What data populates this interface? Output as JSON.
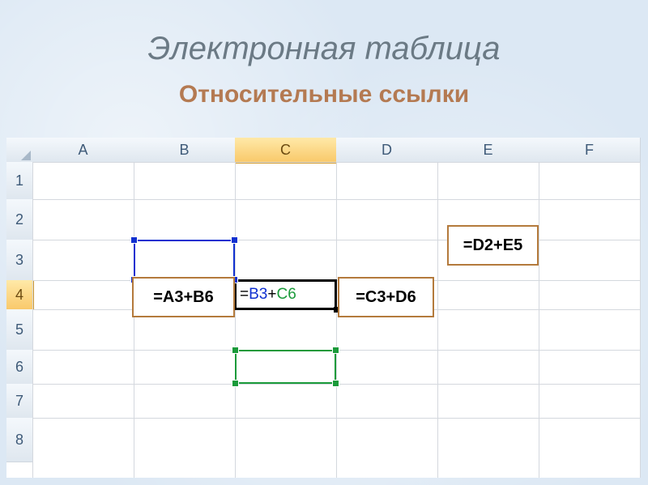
{
  "title": "Электронная таблица",
  "subtitle": "Относительные ссылки",
  "columns": [
    "A",
    "B",
    "C",
    "D",
    "E",
    "F"
  ],
  "rows": [
    "1",
    "2",
    "3",
    "4",
    "5",
    "6",
    "7",
    "8"
  ],
  "active_col_index": 2,
  "active_row_index": 3,
  "edit": {
    "eq": "=",
    "ref1": "B3",
    "plus": "+",
    "ref2": "C6"
  },
  "labels": {
    "b4": "=A3+B6",
    "d4": "=C3+D6",
    "e3": "=D2+E5"
  },
  "range1": {
    "color": "#1030d0"
  },
  "range2": {
    "color": "#1a9a3a"
  }
}
